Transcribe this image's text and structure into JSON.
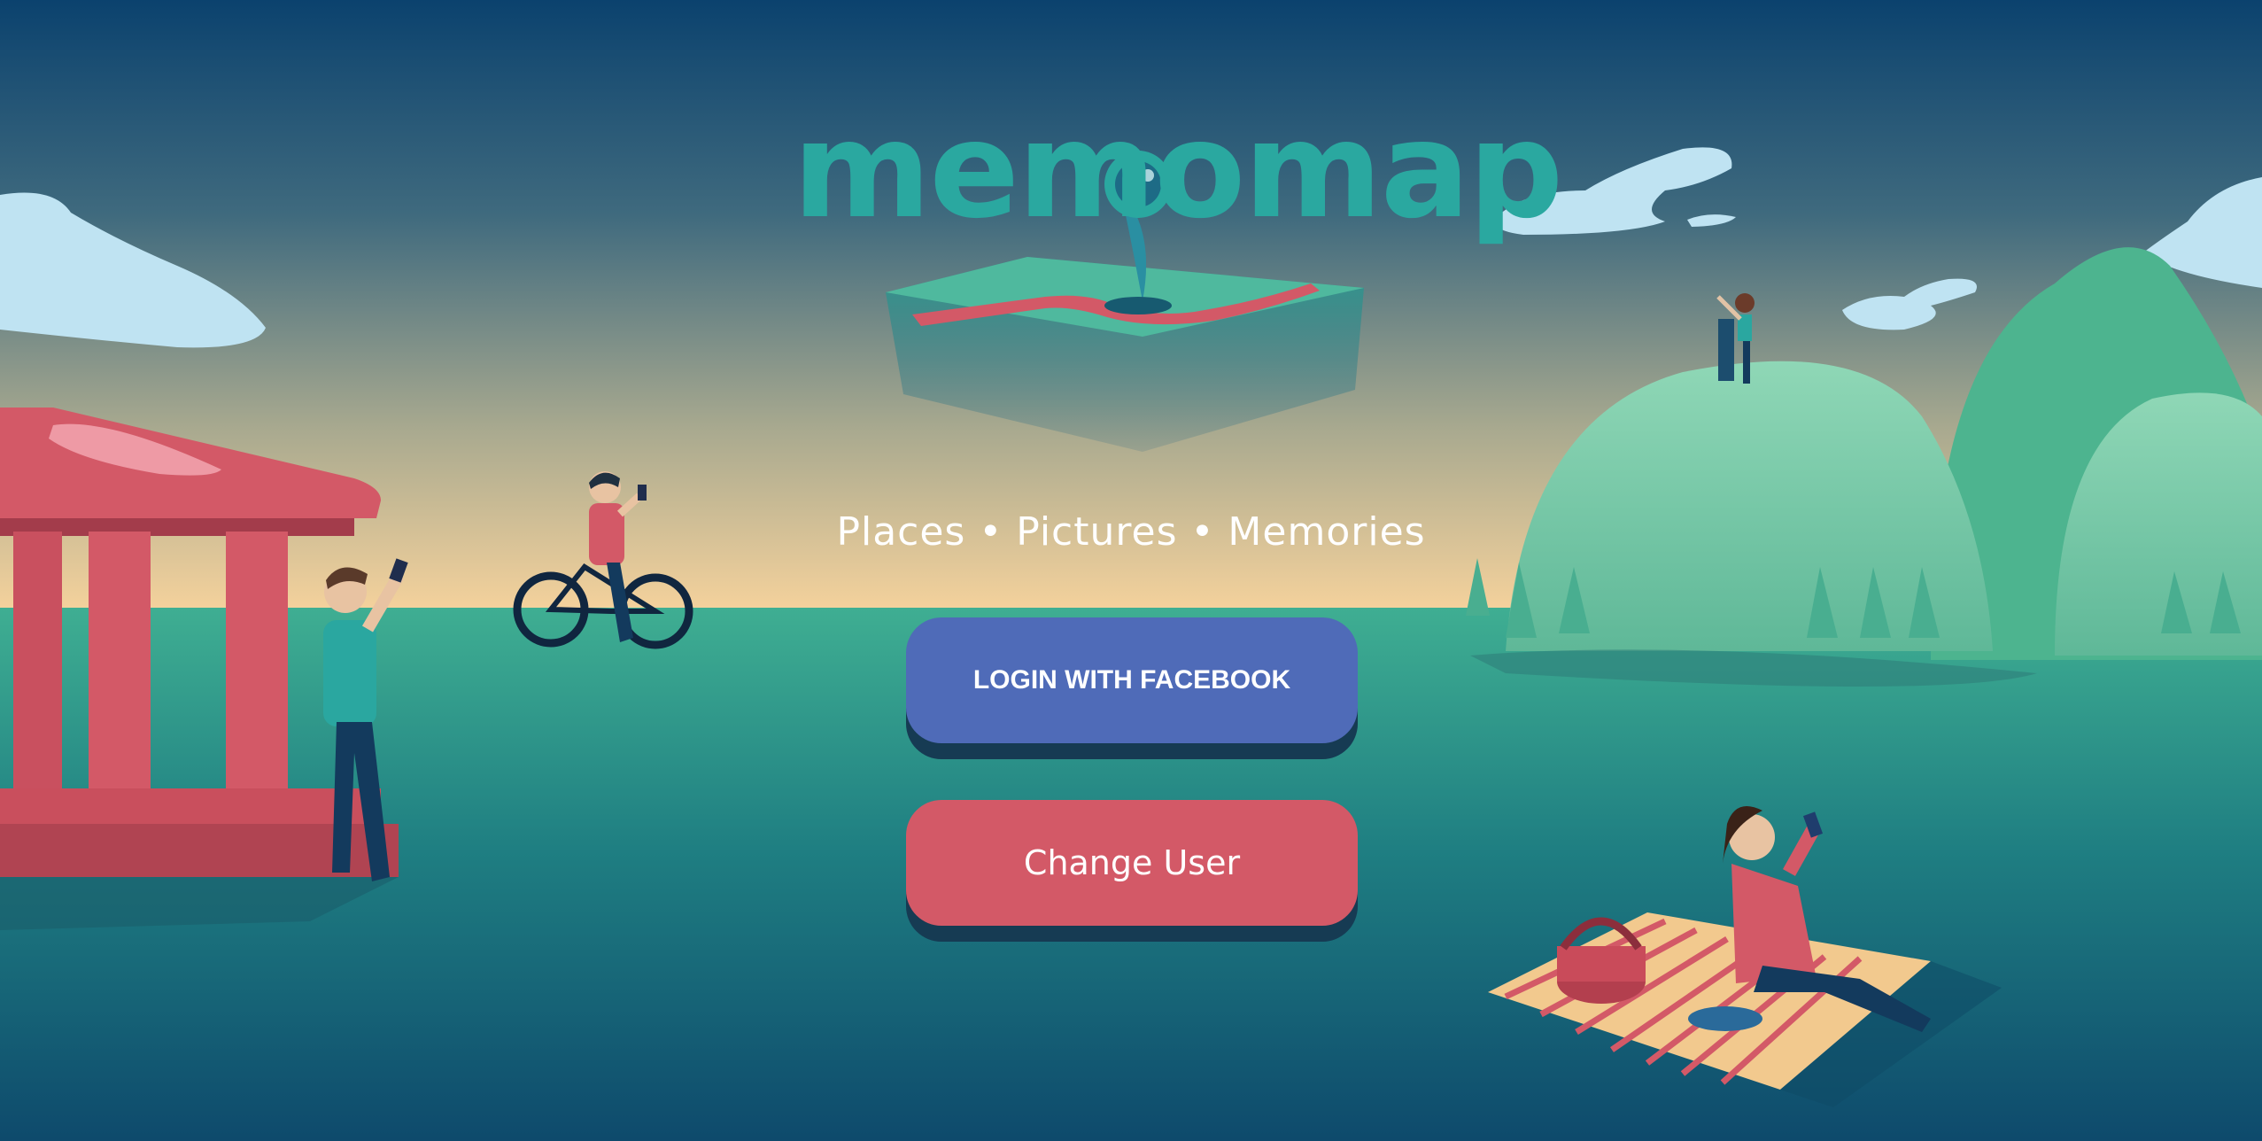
{
  "app": {
    "logo_text": "memomap",
    "tagline": "Places • Pictures • Memories"
  },
  "buttons": {
    "login_facebook": "LOGIN WITH FACEBOOK",
    "change_user": "Change User"
  },
  "colors": {
    "sky_top": "#0b426e",
    "horizon": "#f5d29c",
    "ground": "#3aa58f",
    "facebook_button": "#4f6bb8",
    "change_user_button": "#d35967",
    "logo_teal": "#2aa8a0"
  }
}
